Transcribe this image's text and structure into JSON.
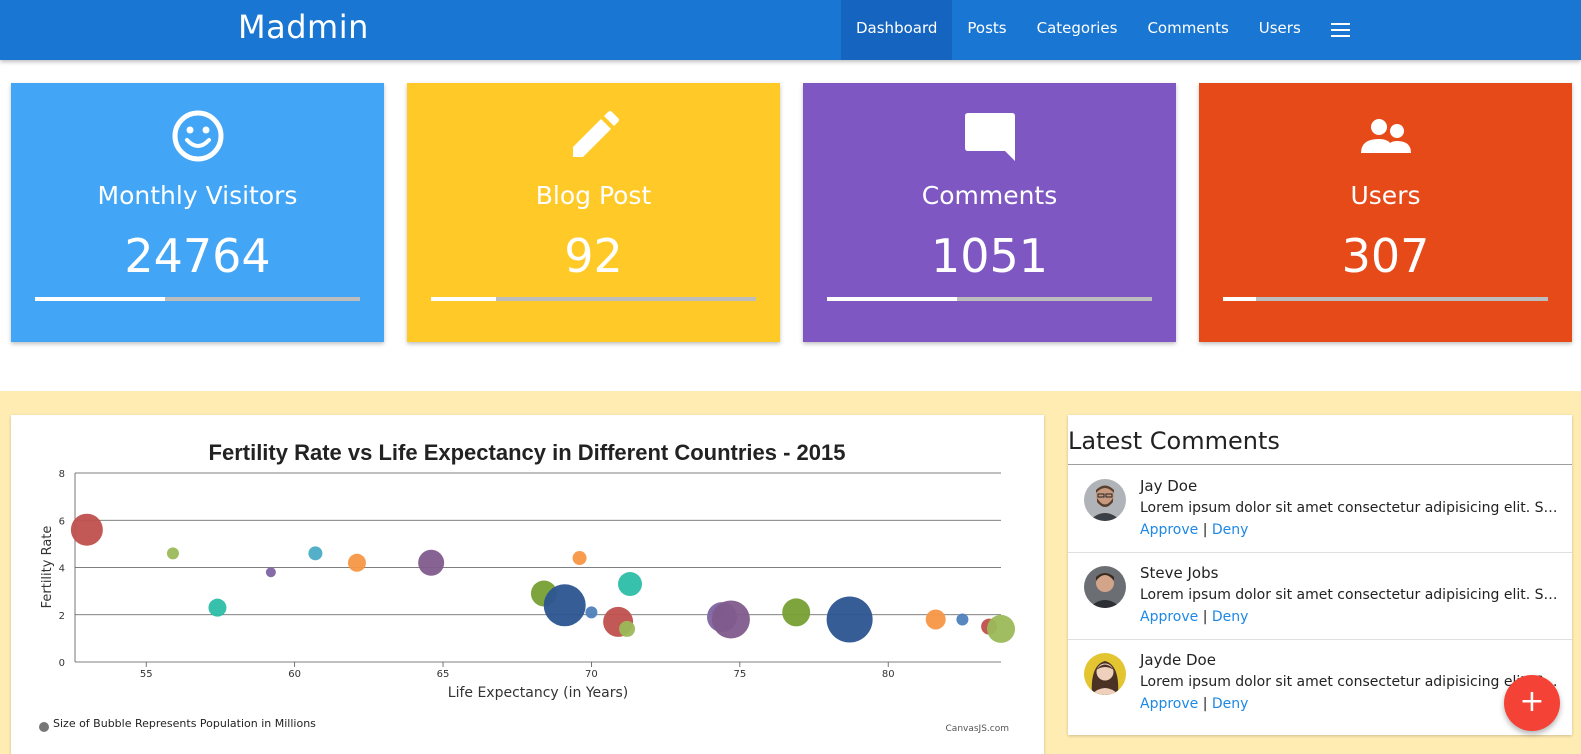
{
  "header": {
    "brand": "Madmin",
    "nav": [
      {
        "label": "Dashboard",
        "active": true
      },
      {
        "label": "Posts",
        "active": false
      },
      {
        "label": "Categories",
        "active": false
      },
      {
        "label": "Comments",
        "active": false
      },
      {
        "label": "Users",
        "active": false
      }
    ],
    "menu_icon": "hamburger-menu-icon",
    "color": "#1976d2"
  },
  "stats": [
    {
      "title": "Monthly Visitors",
      "value": "24764",
      "progress": 0.4,
      "icon": "smiley-face-icon",
      "color": "#42a5f5"
    },
    {
      "title": "Blog Post",
      "value": "92",
      "progress": 0.2,
      "icon": "pencil-icon",
      "color": "#ffca28"
    },
    {
      "title": "Comments",
      "value": "1051",
      "progress": 0.4,
      "icon": "chat-bubble-icon",
      "color": "#7e57c2"
    },
    {
      "title": "Users",
      "value": "307",
      "progress": 0.1,
      "icon": "group-people-icon",
      "color": "#e64a19"
    }
  ],
  "comments_panel": {
    "title": "Latest Comments",
    "items": [
      {
        "name": "Jay Doe",
        "text": "Lorem ipsum dolor sit amet consectetur adipisicing elit. Similique quaerat, dolorum eius tenetur",
        "approve": "Approve",
        "separator": "|",
        "deny": "Deny",
        "avatar": "man-with-beard-avatar"
      },
      {
        "name": "Steve Jobs",
        "text": "Lorem ipsum dolor sit amet consectetur adipisicing elit. Similique quaerat, dolorum eius tenetur",
        "approve": "Approve",
        "separator": "|",
        "deny": "Deny",
        "avatar": "man-portrait-avatar"
      },
      {
        "name": "Jayde Doe",
        "text": "Lorem ipsum dolor sit amet consectetur adipisicing elit. Similique quaerat, dolorum eius tenetur",
        "approve": "Approve",
        "separator": "|",
        "deny": "Deny",
        "avatar": "woman-portrait-avatar"
      }
    ]
  },
  "fab": {
    "label": "+",
    "icon": "plus-icon",
    "color": "#f44336"
  },
  "chart_data": {
    "type": "scatter",
    "title": "Fertility Rate vs Life Expectancy in Different Countries - 2015",
    "xlabel": "Life Expectancy (in Years)",
    "ylabel": "Fertility Rate",
    "xlim": [
      52.6,
      83.8
    ],
    "ylim": [
      0,
      8
    ],
    "xticks": [
      "55",
      "60",
      "65",
      "70",
      "75",
      "80"
    ],
    "yticks": [
      "0",
      "2",
      "4",
      "6",
      "8"
    ],
    "grid": true,
    "legend": "Size of Bubble Represents Population in Millions",
    "credit": "CanvasJS.com",
    "points": [
      {
        "x": 53.0,
        "y": 5.6,
        "size": 16,
        "color": "#c0504d"
      },
      {
        "x": 55.9,
        "y": 4.6,
        "size": 6,
        "color": "#9bbb59"
      },
      {
        "x": 57.4,
        "y": 2.3,
        "size": 9,
        "color": "#2cbea8"
      },
      {
        "x": 59.2,
        "y": 3.8,
        "size": 5,
        "color": "#8064a2"
      },
      {
        "x": 60.7,
        "y": 4.6,
        "size": 7,
        "color": "#4bacc6"
      },
      {
        "x": 62.1,
        "y": 4.2,
        "size": 9,
        "color": "#f79646"
      },
      {
        "x": 64.6,
        "y": 4.2,
        "size": 13,
        "color": "#7f5b8c"
      },
      {
        "x": 68.4,
        "y": 2.9,
        "size": 13,
        "color": "#77a033"
      },
      {
        "x": 69.1,
        "y": 2.4,
        "size": 21,
        "color": "#2c5491"
      },
      {
        "x": 69.6,
        "y": 4.4,
        "size": 7,
        "color": "#f79646"
      },
      {
        "x": 70.0,
        "y": 2.1,
        "size": 6,
        "color": "#4f81bd"
      },
      {
        "x": 70.9,
        "y": 1.7,
        "size": 15,
        "color": "#c0504d"
      },
      {
        "x": 71.2,
        "y": 1.4,
        "size": 8,
        "color": "#9bbb59"
      },
      {
        "x": 71.3,
        "y": 3.3,
        "size": 12,
        "color": "#2cbea8"
      },
      {
        "x": 74.3,
        "y": 2.1,
        "size": 7,
        "color": "#4bacc6"
      },
      {
        "x": 74.4,
        "y": 1.9,
        "size": 15,
        "color": "#8064a2"
      },
      {
        "x": 74.7,
        "y": 1.8,
        "size": 19,
        "color": "#7f5b8c"
      },
      {
        "x": 76.9,
        "y": 2.1,
        "size": 14,
        "color": "#77a033"
      },
      {
        "x": 78.7,
        "y": 1.8,
        "size": 23,
        "color": "#2c5491"
      },
      {
        "x": 81.6,
        "y": 1.8,
        "size": 10,
        "color": "#f79646"
      },
      {
        "x": 82.5,
        "y": 1.8,
        "size": 6,
        "color": "#4f81bd"
      },
      {
        "x": 83.4,
        "y": 1.5,
        "size": 8,
        "color": "#c0504d"
      },
      {
        "x": 83.8,
        "y": 1.4,
        "size": 14,
        "color": "#9bbb59"
      }
    ]
  }
}
